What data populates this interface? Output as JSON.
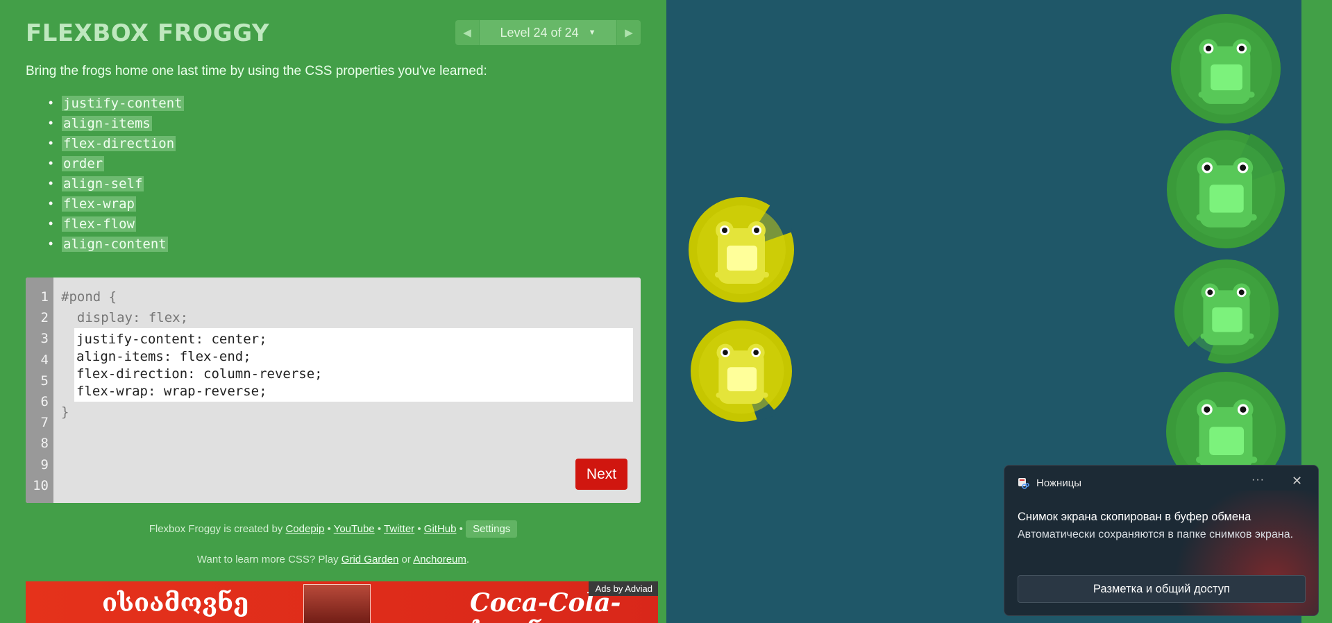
{
  "header": {
    "title": "FLEXBOX FROGGY",
    "level_label": "Level 24 of 24",
    "prev_icon": "triangle-left",
    "next_icon": "triangle-right",
    "dropdown_icon": "caret-down"
  },
  "instructions": "Bring the frogs home one last time by using the CSS properties you've learned:",
  "properties": [
    "justify-content",
    "align-items",
    "flex-direction",
    "order",
    "align-self",
    "flex-wrap",
    "flex-flow",
    "align-content"
  ],
  "editor": {
    "line_numbers": [
      "1",
      "2",
      "3",
      "4",
      "5",
      "6",
      "7",
      "8",
      "9",
      "10"
    ],
    "line1": "#pond {",
    "line2": "  display: flex;",
    "input_lines": [
      "justify-content: center;",
      "align-items: flex-end;",
      "flex-direction: column-reverse;",
      "flex-wrap: wrap-reverse;"
    ],
    "closing": "}",
    "next_label": "Next"
  },
  "credits": {
    "prefix": "Flexbox Froggy is created by",
    "links": [
      "Codepip",
      "YouTube",
      "Twitter",
      "GitHub"
    ],
    "separator": "•",
    "settings_label": "Settings"
  },
  "learn_more": {
    "prefix": "Want to learn more CSS? Play",
    "link1": "Grid Garden",
    "middle": "or",
    "link2": "Anchoreum",
    "suffix": "."
  },
  "ad": {
    "text_left": "ისიამოვნე",
    "text_right": "Coca-Cola-სთან",
    "label": "Ads by Adviad"
  },
  "pond": {
    "colors": {
      "water": "#1f5768",
      "green_pad": "#3a9a3a",
      "green_frog": "#6cd66c",
      "yellow_pad": "#c6c600",
      "yellow_frog": "#f0f05a"
    }
  },
  "toast": {
    "app_name": "Ножницы",
    "more_icon": "ellipsis-icon",
    "close_icon": "close-icon",
    "headline": "Снимок экрана скопирован в буфер обмена",
    "body": "Автоматически сохраняются в папке снимков экрана.",
    "action_label": "Разметка и общий доступ"
  }
}
